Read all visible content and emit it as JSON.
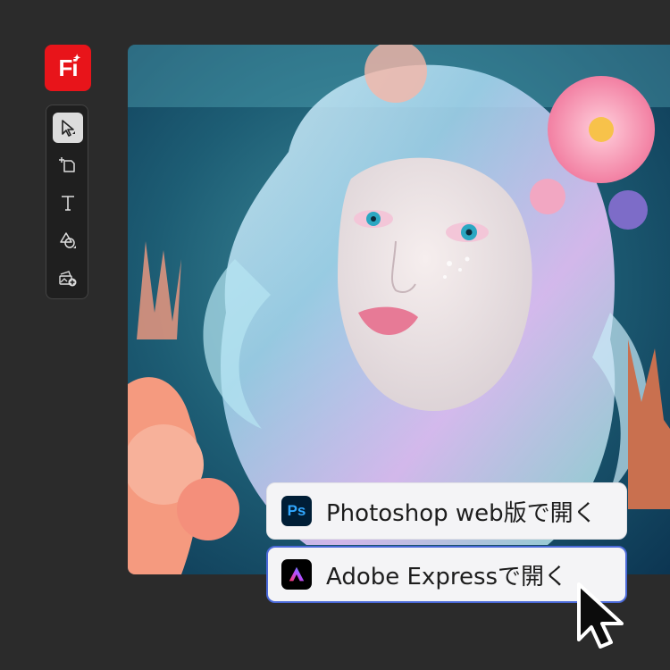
{
  "app": {
    "logo_text": "Fi",
    "brand_color": "#e8141a"
  },
  "toolbar": {
    "tools": [
      {
        "icon": "select-arrow-icon",
        "selected": true
      },
      {
        "icon": "artboard-add-icon",
        "selected": false
      },
      {
        "icon": "text-type-icon",
        "selected": false
      },
      {
        "icon": "shapes-icon",
        "selected": false
      },
      {
        "icon": "image-add-icon",
        "selected": false
      }
    ]
  },
  "canvas": {
    "content": "artwork-image"
  },
  "open_menu": {
    "items": [
      {
        "app_icon_text": "Ps",
        "label": "Photoshop web版で開く",
        "icon_color": "#31a8ff"
      },
      {
        "app_icon": "adobe-express-icon",
        "label": "Adobe Expressで開く",
        "highlighted": true,
        "highlight_color": "#4a69d8"
      }
    ]
  }
}
